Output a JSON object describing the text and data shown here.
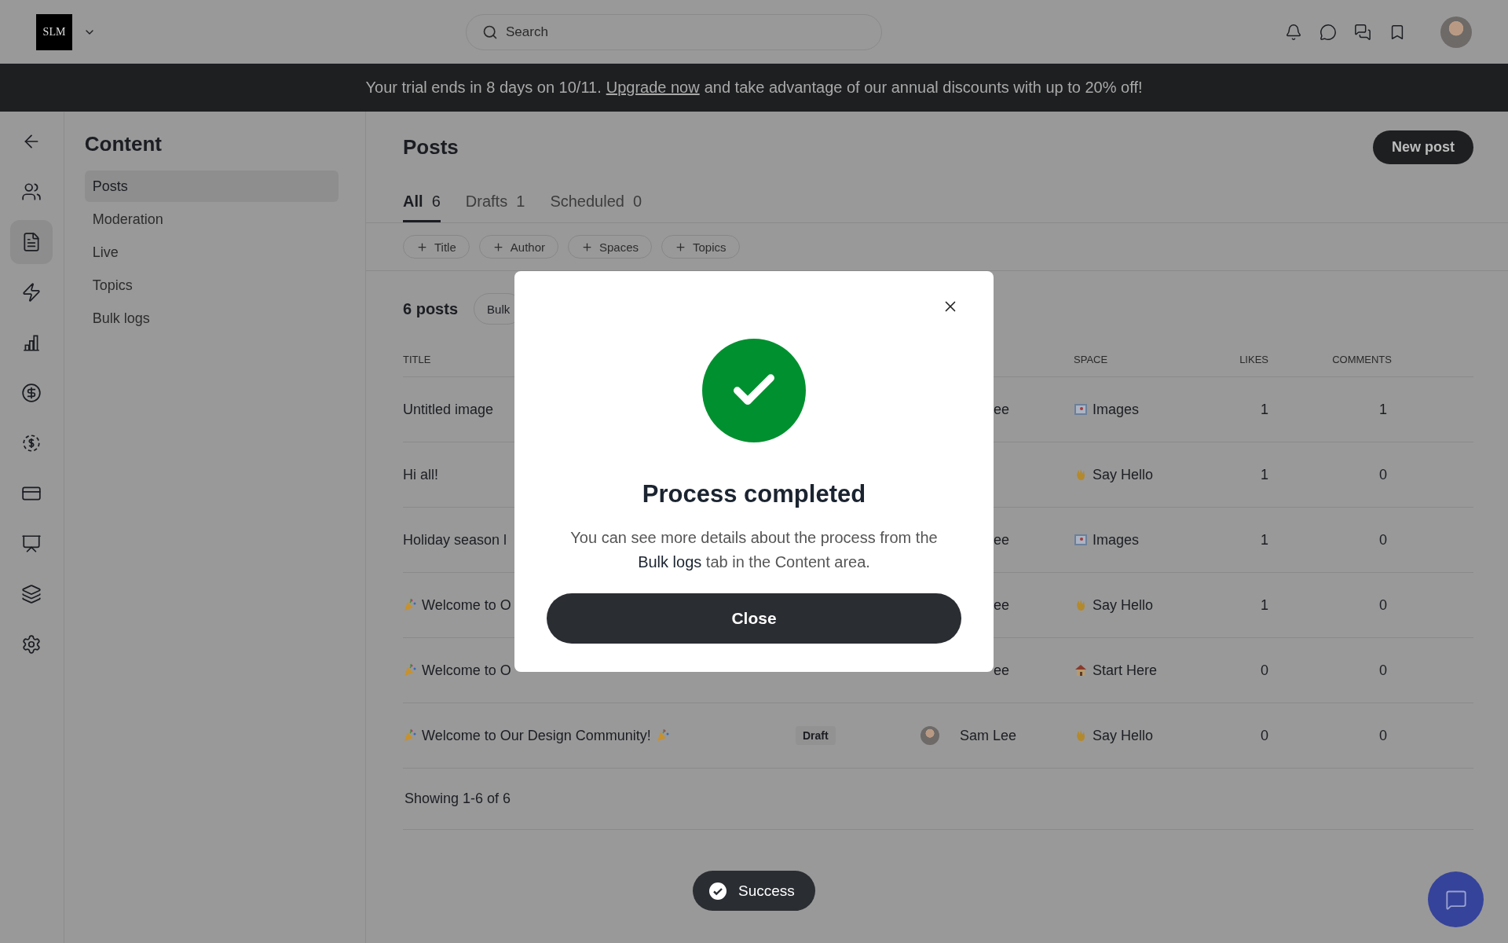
{
  "top_bar": {
    "logo": "SLM",
    "search": {
      "placeholder": "Search"
    }
  },
  "banner": {
    "before": "Your trial ends in 8 days on 10/11.",
    "link": "Upgrade now",
    "after": "and take advantage of our annual discounts with up to 20% off!"
  },
  "rail": [
    {
      "kind": "back",
      "selected": false
    },
    {
      "kind": "members",
      "selected": false
    },
    {
      "kind": "content",
      "selected": true
    },
    {
      "kind": "automation",
      "selected": false
    },
    {
      "kind": "analytics",
      "selected": false
    },
    {
      "kind": "billing",
      "selected": false
    },
    {
      "kind": "monetization",
      "selected": false
    },
    {
      "kind": "payments",
      "selected": false
    },
    {
      "kind": "display",
      "selected": false
    },
    {
      "kind": "apps",
      "selected": false
    },
    {
      "kind": "settings",
      "selected": false
    }
  ],
  "sidebar": {
    "title": "Content",
    "items": [
      {
        "label": "Posts",
        "selected": true
      },
      {
        "label": "Moderation",
        "selected": false
      },
      {
        "label": "Live",
        "selected": false
      },
      {
        "label": "Topics",
        "selected": false
      },
      {
        "label": "Bulk logs",
        "selected": false
      }
    ]
  },
  "main": {
    "title": "Posts",
    "new_button": "New post",
    "tabs": [
      {
        "label": "All",
        "count": "6",
        "selected": true
      },
      {
        "label": "Drafts",
        "count": "1",
        "selected": false
      },
      {
        "label": "Scheduled",
        "count": "0",
        "selected": false
      }
    ],
    "filters": [
      "Title",
      "Author",
      "Spaces",
      "Topics"
    ],
    "count": "6 posts",
    "bulk_button": "Bulk",
    "table": {
      "columns": [
        "TITLE",
        "SPACE",
        "LIKES",
        "COMMENTS"
      ],
      "rows": [
        {
          "title": "Untitled image",
          "party_before": false,
          "party_after": false,
          "author": "ee",
          "avatar": false,
          "space": {
            "kind": "picture",
            "name": "Images"
          },
          "likes": "1",
          "comments": "1"
        },
        {
          "title": "Hi all!",
          "party_before": false,
          "party_after": false,
          "space": {
            "kind": "wave",
            "name": "Say Hello"
          },
          "likes": "1",
          "comments": "0"
        },
        {
          "title": "Holiday season l",
          "party_before": false,
          "party_after": false,
          "author": "ee",
          "avatar": false,
          "space": {
            "kind": "picture",
            "name": "Images"
          },
          "likes": "1",
          "comments": "0"
        },
        {
          "title": "Welcome to O",
          "party_before": true,
          "party_after": false,
          "author": "ee",
          "avatar": false,
          "space": {
            "kind": "wave",
            "name": "Say Hello"
          },
          "likes": "1",
          "comments": "0"
        },
        {
          "title": "Welcome to O",
          "party_before": true,
          "party_after": false,
          "author": "ee",
          "avatar": false,
          "space": {
            "kind": "house",
            "name": "Start Here"
          },
          "likes": "0",
          "comments": "0"
        },
        {
          "title": "Welcome to Our Design Community!",
          "party_before": true,
          "party_after": true,
          "status": "Draft",
          "author": "Sam Lee",
          "avatar": true,
          "space": {
            "kind": "wave",
            "name": "Say Hello"
          },
          "likes": "0",
          "comments": "0"
        }
      ]
    },
    "footer": "Showing 1-6 of 6"
  },
  "dialog": {
    "title": "Process completed",
    "message": "You can see more details about the process from the **Bulk logs** tab in the Content area.",
    "button": "Close"
  },
  "toast": {
    "text": "Success"
  }
}
